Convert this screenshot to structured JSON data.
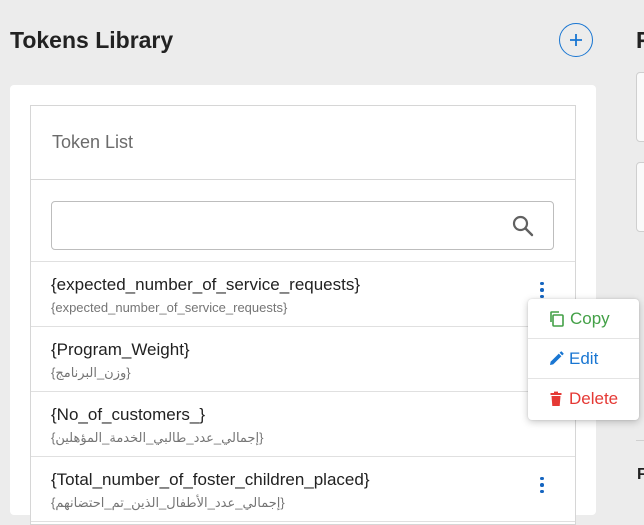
{
  "header": {
    "title": "Tokens Library",
    "add_icon": "plus-circle-icon"
  },
  "right_panel": {
    "title_fragment": "F",
    "bottom_fragment": "F"
  },
  "token_list": {
    "title": "Token List",
    "search": {
      "value": "",
      "placeholder": "",
      "icon": "search-icon"
    },
    "items": [
      {
        "name": "{expected_number_of_service_requests}",
        "subtitle": "{expected_number_of_service_requests}"
      },
      {
        "name": "{Program_Weight}",
        "subtitle": "{وزن_البرنامج}"
      },
      {
        "name": "{No_of_customers_}",
        "subtitle": "{إجمالي_عدد_طالبي_الخدمة_المؤهلين}"
      },
      {
        "name": "{Total_number_of_foster_children_placed}",
        "subtitle": "{إجمالي_عدد_الأطفال_الذين_تم_احتضانهم}"
      }
    ]
  },
  "context_menu": {
    "items": [
      {
        "label": "Copy",
        "icon": "copy-icon",
        "color": "#43a047"
      },
      {
        "label": "Edit",
        "icon": "pencil-icon",
        "color": "#1976d2"
      },
      {
        "label": "Delete",
        "icon": "trash-icon",
        "color": "#e53935"
      }
    ]
  },
  "colors": {
    "accent": "#1976d2",
    "background": "#ececec",
    "card": "#ffffff"
  }
}
